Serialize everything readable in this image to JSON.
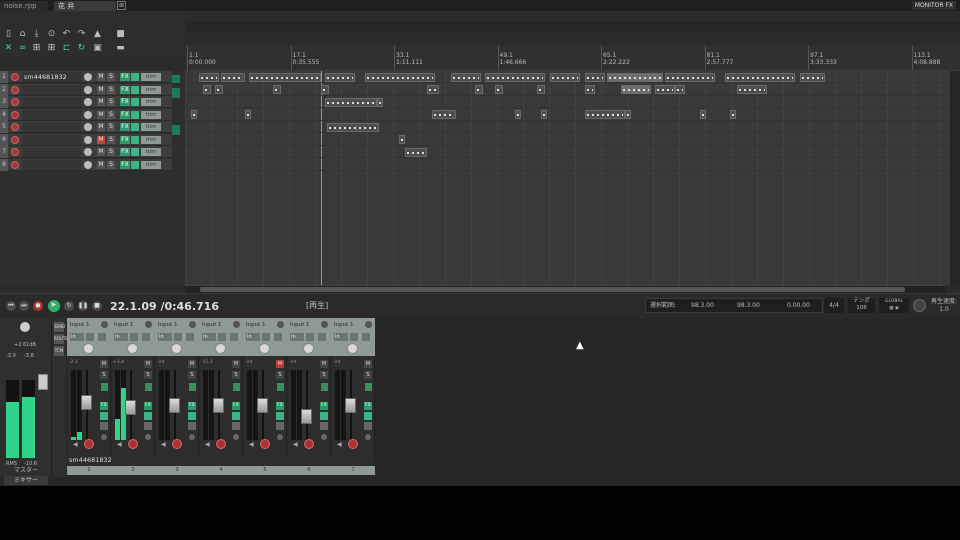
{
  "tabs": [
    {
      "label": "noise.rpp"
    },
    {
      "label": "花 弁 .remix.rpp"
    }
  ],
  "tab_close": "⊠",
  "monitor_fx": "MONITOR FX",
  "ruler": {
    "marks": [
      {
        "bar": "1.1",
        "time": "0:00.000"
      },
      {
        "bar": "17.1",
        "time": "0:35.555"
      },
      {
        "bar": "33.1",
        "time": "1:11.111"
      },
      {
        "bar": "49.1",
        "time": "1:46.666"
      },
      {
        "bar": "65.1",
        "time": "2:22.222"
      },
      {
        "bar": "81.1",
        "time": "2:57.777"
      },
      {
        "bar": "97.1",
        "time": "3:33.333"
      },
      {
        "bar": "113.1",
        "time": "4:08.888"
      }
    ]
  },
  "tracks": [
    {
      "num": "1",
      "name": "sm44681832",
      "muted": false
    },
    {
      "num": "2",
      "name": "",
      "muted": false
    },
    {
      "num": "3",
      "name": "",
      "muted": false
    },
    {
      "num": "4",
      "name": "",
      "muted": false
    },
    {
      "num": "5",
      "name": "",
      "muted": false
    },
    {
      "num": "6",
      "name": "",
      "muted": true
    },
    {
      "num": "7",
      "name": "",
      "muted": false
    },
    {
      "num": "8",
      "name": "",
      "muted": false
    }
  ],
  "track_buttons": {
    "mute": "M",
    "solo": "S",
    "fx": "FX",
    "trim": "trim"
  },
  "transport": {
    "time": "22.1.09 /0:46.716",
    "status": "[再生]",
    "selection_label": "選択範囲:",
    "selection_start": "98.3.00",
    "selection_end": "98.3.00",
    "selection_length": "0.00.00",
    "time_signature": "4/4",
    "tempo_label": "テンポ",
    "tempo_value": "108",
    "global_label": "GLOBAL",
    "rate_label": "再生速度:",
    "rate_value": "1.0"
  },
  "master": {
    "db_top": "+2.61dB",
    "peak_l": "-3.0",
    "peak_r": "-3.8",
    "rms_label": "RMS",
    "rms_value": "-10.6",
    "label": "マスター",
    "level_l": 0.72,
    "level_r": 0.78
  },
  "mixer_label": "ミキサー",
  "mixer_side": [
    "SEND",
    "ROUTE",
    "TCM"
  ],
  "strips": [
    {
      "input": "Input 1",
      "in": "In",
      "db": "-2.1",
      "name": "sm44681832",
      "num": "1",
      "level": 0.12,
      "fader": 0.55,
      "mon": false
    },
    {
      "input": "Input 1",
      "in": "In",
      "db": "+3.4",
      "name": "",
      "num": "2",
      "level": 0.75,
      "fader": 0.45,
      "mon": false
    },
    {
      "input": "Input 1",
      "in": "In",
      "db": "-inf",
      "name": "",
      "num": "3",
      "level": 0,
      "fader": 0.5,
      "mon": false
    },
    {
      "input": "Input 1",
      "in": "In",
      "db": "-11.3",
      "name": "",
      "num": "4",
      "level": 0,
      "fader": 0.5,
      "mon": false
    },
    {
      "input": "Input 1",
      "in": "In",
      "db": "-inf",
      "name": "",
      "num": "5",
      "level": 0,
      "fader": 0.5,
      "mon": true
    },
    {
      "input": "Input 1",
      "in": "In",
      "db": "-inf",
      "name": "",
      "num": "6",
      "level": 0,
      "fader": 0.3,
      "mon": false
    },
    {
      "input": "Input 1",
      "in": "In",
      "db": "-inf",
      "name": "",
      "num": "7",
      "level": 0,
      "fader": 0.5,
      "mon": false
    }
  ],
  "colors": {
    "accent_green": "#2fd48a",
    "mute_red": "#b84a3a",
    "fx_green": "#2c9b6b",
    "cursor": "#b89a44"
  }
}
